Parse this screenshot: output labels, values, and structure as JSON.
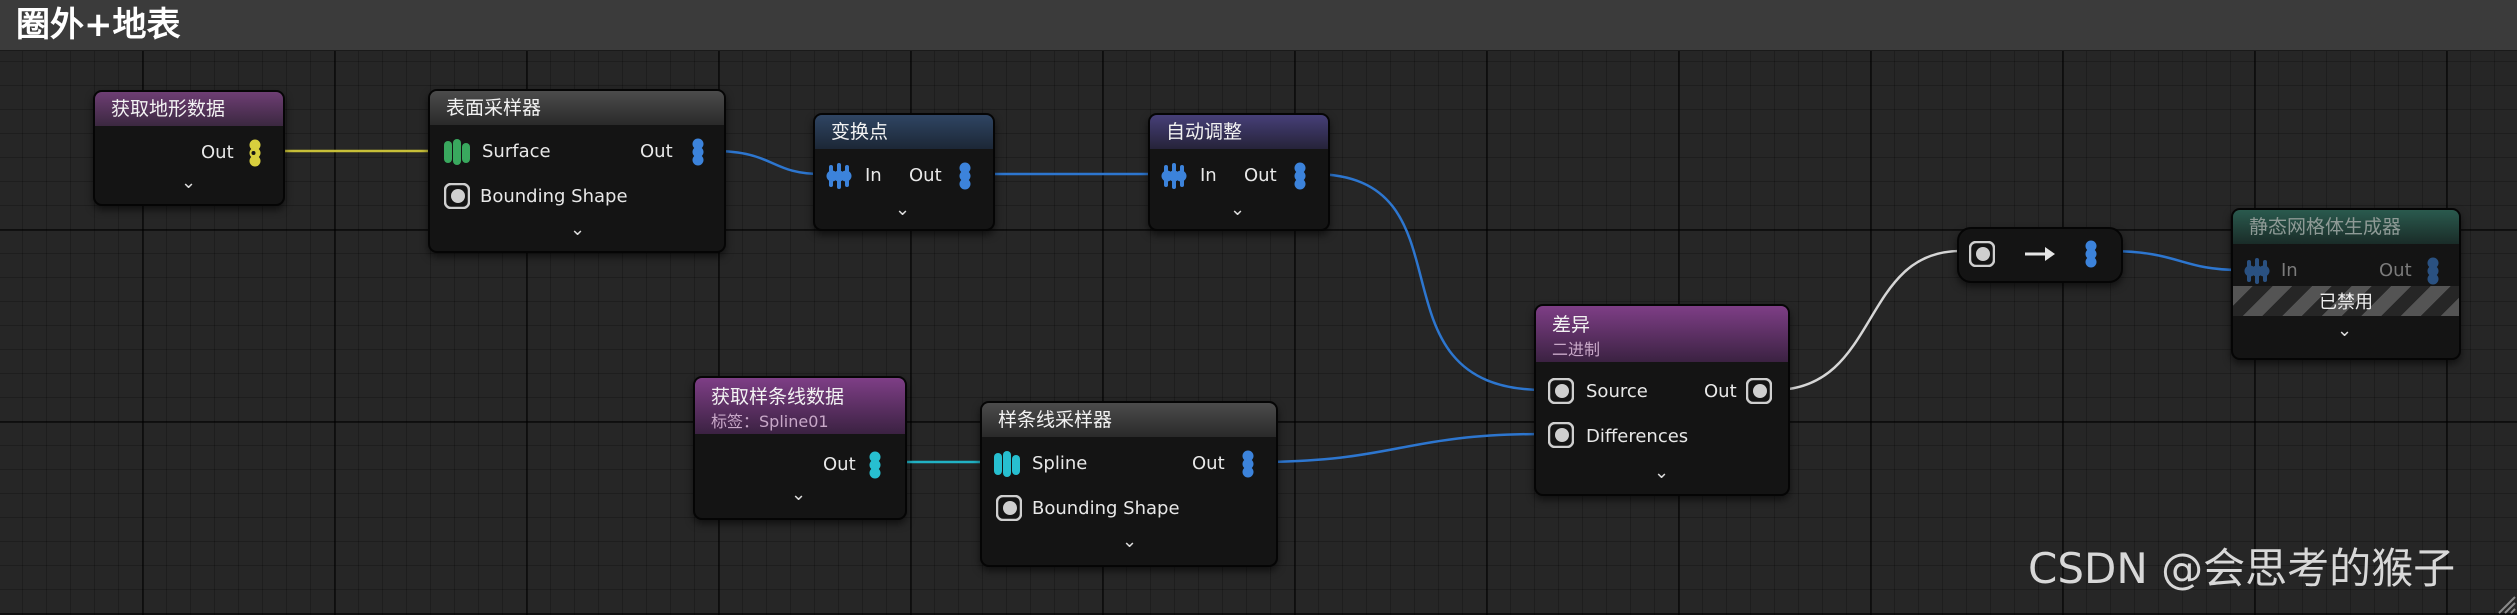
{
  "graph": {
    "title": "圈外+地表"
  },
  "nodes": {
    "get_landscape": {
      "title": "获取地形数据",
      "out": "Out"
    },
    "surface_sampler": {
      "title": "表面采样器",
      "surface": "Surface",
      "bounding": "Bounding Shape",
      "out": "Out"
    },
    "transform_points": {
      "title": "变换点",
      "in": "In",
      "out": "Out"
    },
    "self_pruning": {
      "title": "自动调整",
      "in": "In",
      "out": "Out"
    },
    "get_spline": {
      "title": "获取样条线数据",
      "subtitle": "标签：Spline01",
      "out": "Out"
    },
    "spline_sampler": {
      "title": "样条线采样器",
      "spline": "Spline",
      "bounding": "Bounding Shape",
      "out": "Out"
    },
    "difference": {
      "title": "差异",
      "subtitle": "二进制",
      "source": "Source",
      "differences": "Differences",
      "out": "Out"
    },
    "static_mesh_spawner": {
      "title": "静态网格体生成器",
      "in": "In",
      "out": "Out",
      "disabled": "已禁用"
    }
  },
  "watermark": "CSDN @会思考的猴子",
  "colors": {
    "wire_surface": "#c7bf38",
    "wire_point": "#2d76cf",
    "wire_spline": "#21b2c4",
    "wire_spatial": "#d6d6d6"
  }
}
